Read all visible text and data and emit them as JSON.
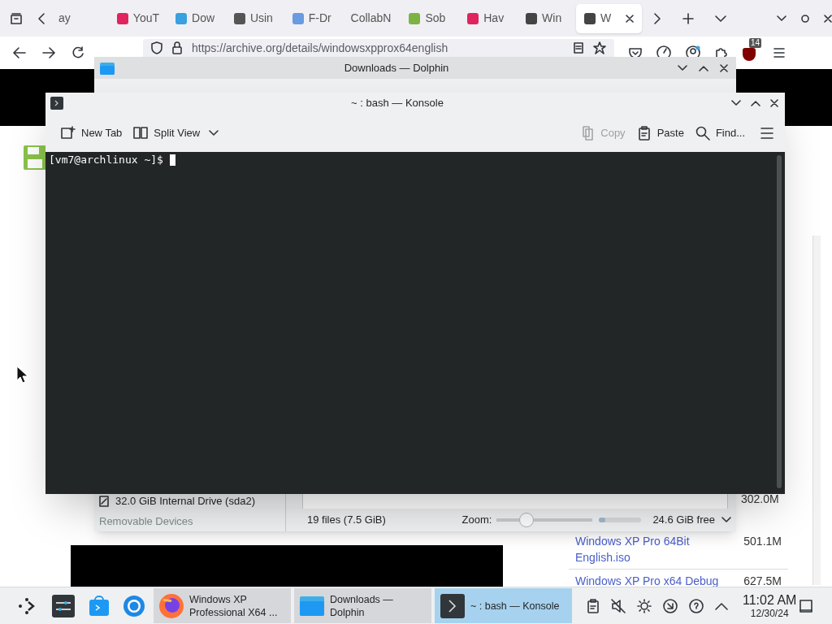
{
  "browser": {
    "tabs": [
      {
        "label": "ay",
        "selected": false
      },
      {
        "label": "YouT",
        "selected": false
      },
      {
        "label": "Dow",
        "selected": false
      },
      {
        "label": "Usin",
        "selected": false
      },
      {
        "label": "F-Dr",
        "selected": false
      },
      {
        "label": "CollabN",
        "selected": false
      },
      {
        "label": "Sob",
        "selected": false
      },
      {
        "label": "Hav",
        "selected": false
      },
      {
        "label": "Win",
        "selected": false
      },
      {
        "label": "W",
        "selected": true
      }
    ],
    "url": "https://archive.org/details/windowsxpprox64english",
    "extension_badge": "14",
    "page": {
      "partial_size": "302.0M",
      "files": [
        {
          "name": "Windows XP Pro 64Bit English.iso",
          "size": "501.1M"
        },
        {
          "name": "Windows XP Pro x64 Debug",
          "size": "627.5M"
        }
      ]
    }
  },
  "dolphin": {
    "title": "Downloads — Dolphin",
    "drive": "32.0 GiB Internal Drive (sda2)",
    "section": "Removable Devices",
    "status": "19 files (7.5 GiB)",
    "zoom_label": "Zoom:",
    "zoom": {
      "level": 0.28
    },
    "space": {
      "level": 0.15
    },
    "free": "24.6 GiB free"
  },
  "konsole": {
    "title": "~ : bash — Konsole",
    "toolbar_left": [
      {
        "kind": "new-tab",
        "label": "New Tab",
        "disabled": false
      },
      {
        "kind": "split",
        "label": "Split View",
        "disabled": false
      }
    ],
    "toolbar_right": [
      {
        "kind": "copy",
        "label": "Copy",
        "disabled": true
      },
      {
        "kind": "paste",
        "label": "Paste",
        "disabled": false
      },
      {
        "kind": "find",
        "label": "Find...",
        "disabled": false
      }
    ],
    "prompt": "[vm7@archlinux ~]$"
  },
  "taskbar": {
    "tasks": [
      {
        "kind": "firefox",
        "label": "Windows XP Professional X64 ...",
        "selected": false
      },
      {
        "kind": "folder",
        "label": "Downloads — Dolphin",
        "selected": false
      },
      {
        "kind": "terminal",
        "label": "~ : bash — Konsole",
        "selected": true
      }
    ],
    "time": "11:02 AM",
    "date": "12/30/24"
  }
}
